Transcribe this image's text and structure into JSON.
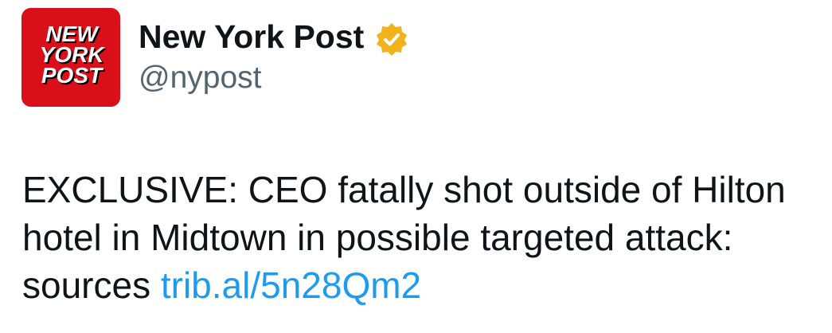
{
  "account": {
    "display_name": "New York Post",
    "handle": "@nypost",
    "verified": true,
    "verified_badge_color": "#f2b21b",
    "avatar": {
      "logo_lines": [
        "NEW",
        "YORK",
        "POST"
      ],
      "background_color": "#d9101a"
    }
  },
  "tweet": {
    "text": "EXCLUSIVE: CEO fatally shot outside of Hilton hotel in Midtown in possible targeted attack: sources",
    "link_text": "trib.al/5n28Qm2",
    "link_color": "#1d9bf0"
  }
}
